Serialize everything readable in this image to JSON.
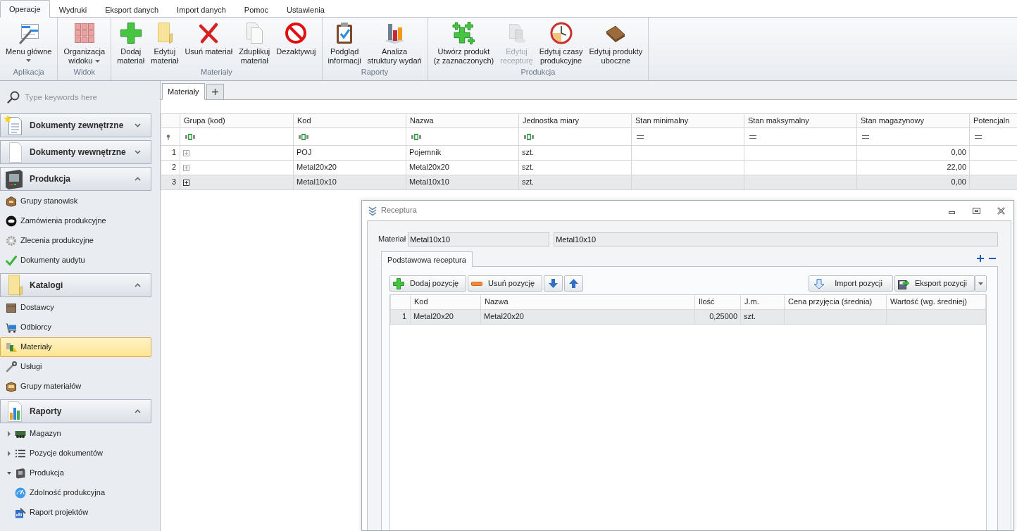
{
  "ribbon": {
    "tabs": [
      {
        "label": "Operacje",
        "selected": true
      },
      {
        "label": "Wydruki",
        "selected": false
      },
      {
        "label": "Eksport danych",
        "selected": false
      },
      {
        "label": "Import danych",
        "selected": false
      },
      {
        "label": "Pomoc",
        "selected": false
      },
      {
        "label": "Ustawienia",
        "selected": false
      }
    ],
    "groups": [
      {
        "label": "Aplikacja",
        "buttons": [
          {
            "lines": [
              "Menu główne"
            ],
            "dropdown": true,
            "disabled": false
          }
        ]
      },
      {
        "label": "Widok",
        "buttons": [
          {
            "lines": [
              "Organizacja",
              "widoku"
            ],
            "dropdown": true,
            "disabled": false
          }
        ]
      },
      {
        "label": "Materiały",
        "buttons": [
          {
            "lines": [
              "Dodaj",
              "materiał"
            ],
            "dropdown": false,
            "disabled": false
          },
          {
            "lines": [
              "Edytuj",
              "materiał"
            ],
            "dropdown": false,
            "disabled": false
          },
          {
            "lines": [
              "Usuń materiał"
            ],
            "dropdown": false,
            "disabled": false
          },
          {
            "lines": [
              "Zduplikuj",
              "materiał"
            ],
            "dropdown": false,
            "disabled": false
          },
          {
            "lines": [
              "Dezaktywuj"
            ],
            "dropdown": false,
            "disabled": false
          }
        ]
      },
      {
        "label": "Raporty",
        "buttons": [
          {
            "lines": [
              "Podgląd",
              "informacji"
            ],
            "dropdown": false,
            "disabled": false
          },
          {
            "lines": [
              "Analiza",
              "struktury wydań"
            ],
            "dropdown": false,
            "disabled": false
          }
        ]
      },
      {
        "label": "Produkcja",
        "buttons": [
          {
            "lines": [
              "Utwórz produkt",
              "(z zaznaczonych)"
            ],
            "dropdown": false,
            "disabled": false
          },
          {
            "lines": [
              "Edytuj",
              "recepturę"
            ],
            "dropdown": false,
            "disabled": true
          },
          {
            "lines": [
              "Edytuj czasy",
              "produkcyjne"
            ],
            "dropdown": false,
            "disabled": false
          },
          {
            "lines": [
              "Edytuj produkty",
              "uboczne"
            ],
            "dropdown": false,
            "disabled": false
          }
        ]
      }
    ]
  },
  "sidebar": {
    "search": {
      "placeholder": "Type keywords here"
    },
    "sections": [
      {
        "title": "Dokumenty zewnętrzne",
        "expanded": false
      },
      {
        "title": "Dokumenty wewnętrzne",
        "expanded": false
      },
      {
        "title": "Produkcja",
        "expanded": true,
        "items": [
          {
            "label": "Grupy stanowisk",
            "selected": false
          },
          {
            "label": "Zamówienia produkcyjne",
            "selected": false
          },
          {
            "label": "Zlecenia produkcyjne",
            "selected": false
          },
          {
            "label": "Dokumenty audytu",
            "selected": false
          }
        ]
      },
      {
        "title": "Katalogi",
        "expanded": true,
        "items": [
          {
            "label": "Dostawcy",
            "selected": false
          },
          {
            "label": "Odbiorcy",
            "selected": false
          },
          {
            "label": "Materiały",
            "selected": true
          },
          {
            "label": "Usługi",
            "selected": false
          },
          {
            "label": "Grupy materiałów",
            "selected": false
          }
        ]
      },
      {
        "title": "Raporty",
        "expanded": true,
        "items": [
          {
            "label": "Magazyn",
            "expanded": false,
            "selected": false
          },
          {
            "label": "Pozycje dokumentów",
            "expanded": false,
            "selected": false
          },
          {
            "label": "Produkcja",
            "expanded": true,
            "selected": false,
            "children": [
              {
                "label": "Zdolność produkcyjna",
                "selected": false
              },
              {
                "label": "Raport projektów",
                "selected": false
              }
            ]
          }
        ]
      }
    ]
  },
  "workspace": {
    "tabs": [
      {
        "label": "Materiały",
        "selected": true
      }
    ],
    "grid": {
      "columns": [
        {
          "label": "Grupa (kod)",
          "kind": "group"
        },
        {
          "label": "Kod",
          "kind": "text"
        },
        {
          "label": "Nazwa",
          "kind": "text"
        },
        {
          "label": "Jednostka miary",
          "kind": "text"
        },
        {
          "label": "Stan minimalny",
          "kind": "number"
        },
        {
          "label": "Stan maksymalny",
          "kind": "number"
        },
        {
          "label": "Stan magazynowy",
          "kind": "number"
        },
        {
          "label": "Potencjaln",
          "kind": "number"
        }
      ],
      "rows": [
        {
          "number": "1",
          "selected": false,
          "expanded": false,
          "cells": [
            null,
            "POJ",
            "Pojemnik",
            "szt.",
            null,
            null,
            "0,00",
            null
          ]
        },
        {
          "number": "2",
          "selected": false,
          "expanded": false,
          "cells": [
            null,
            "Metal20x20",
            "Metal20x20",
            "szt.",
            null,
            null,
            "22,00",
            null
          ]
        },
        {
          "number": "3",
          "selected": true,
          "expanded": false,
          "cells": [
            null,
            "Metal10x10",
            "Metal10x10",
            "szt.",
            null,
            null,
            "0,00",
            null
          ]
        }
      ]
    }
  },
  "recipe_window": {
    "title": "Receptura",
    "material": {
      "label": "Materiał",
      "code": "Metal10x10",
      "name": "Metal10x10"
    },
    "tabs": [
      {
        "label": "Podstawowa receptura",
        "selected": true
      }
    ],
    "toolbar": {
      "left": [
        {
          "label": "Dodaj pozycję"
        },
        {
          "label": "Usuń pozycję"
        }
      ],
      "right": [
        {
          "label": "Import pozycji",
          "dropdown": false
        },
        {
          "label": "Eksport pozycji",
          "dropdown": true
        }
      ]
    },
    "grid": {
      "columns": [
        {
          "label": "Kod",
          "kind": "text"
        },
        {
          "label": "Nazwa",
          "kind": "text"
        },
        {
          "label": "Ilość",
          "kind": "number"
        },
        {
          "label": "J.m.",
          "kind": "text"
        },
        {
          "label": "Cena przyjęcia (średnia)",
          "kind": "number"
        },
        {
          "label": "Wartość (wg. średniej)",
          "kind": "number"
        }
      ],
      "rows": [
        {
          "number": "1",
          "selected": true,
          "cells": [
            "Metal20x20",
            "Metal20x20",
            "0,25000",
            "szt.",
            null,
            null
          ]
        }
      ]
    }
  }
}
